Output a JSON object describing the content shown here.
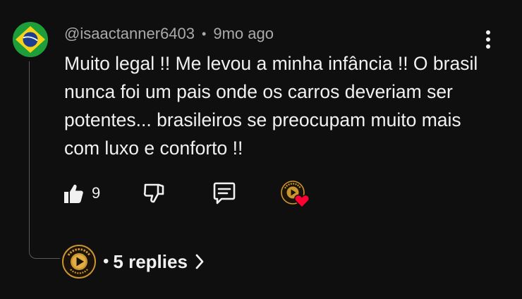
{
  "comment": {
    "author_handle": "@isaactanner6403",
    "separator": "•",
    "time_ago": "9mo ago",
    "text": "Muito legal !! Me levou a minha infância !! O brasil nunca foi um pais onde os carros deveriam ser potentes... brasileiros se preocupam muito mais com luxo e conforto !!",
    "avatar_icon": "brazil-flag",
    "like_count": "9"
  },
  "actions": {
    "like_icon": "thumbs-up-filled-icon",
    "dislike_icon": "thumbs-down-icon",
    "reply_icon": "comment-icon",
    "creator_heart_icon": "channel-logo-with-heart",
    "heart_color": "#ff0033"
  },
  "replies": {
    "separator": "•",
    "label": "5 replies",
    "channel_logo_text_top": "LU DAMEN",
    "channel_logo_text_bottom": "CHANNEL",
    "chevron_icon": "chevron-right-icon"
  },
  "colors": {
    "background": "#0f0f0f",
    "primary_text": "#f1f1f1",
    "secondary_text": "#aaaaaa",
    "logo_gold": "#c9952e"
  }
}
